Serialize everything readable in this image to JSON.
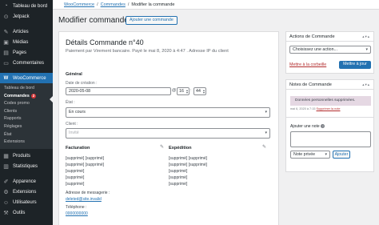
{
  "sidebar": {
    "top_items": [
      {
        "label": "Tableau de bord",
        "icon": "dashboard-icon",
        "glyph": "◔"
      },
      {
        "label": "Jetpack",
        "icon": "jetpack-icon",
        "glyph": "⊙"
      }
    ],
    "content_items": [
      {
        "label": "Articles",
        "icon": "pin-icon",
        "glyph": "✎"
      },
      {
        "label": "Médias",
        "icon": "media-icon",
        "glyph": "▣"
      },
      {
        "label": "Pages",
        "icon": "pages-icon",
        "glyph": "▤"
      },
      {
        "label": "Commentaires",
        "icon": "comments-icon",
        "glyph": "▭"
      }
    ],
    "woocommerce": {
      "label": "WooCommerce",
      "icon": "woocommerce-icon",
      "glyph": "W"
    },
    "submenu": [
      {
        "label": "Tableau de bord"
      },
      {
        "label": "Commandes",
        "badge": "2",
        "current": true
      },
      {
        "label": "Codes promo"
      },
      {
        "label": "Clients"
      },
      {
        "label": "Rapports"
      },
      {
        "label": "Réglages"
      },
      {
        "label": "État"
      },
      {
        "label": "Extensions"
      }
    ],
    "bottom_items": [
      {
        "label": "Produits",
        "icon": "products-icon",
        "glyph": "▦"
      },
      {
        "label": "Statistiques",
        "icon": "stats-icon",
        "glyph": "▥"
      },
      {
        "label": "Apparence",
        "icon": "appearance-icon",
        "glyph": "✐"
      },
      {
        "label": "Extensions",
        "icon": "plugins-icon",
        "glyph": "⚙"
      },
      {
        "label": "Utilisateurs",
        "icon": "users-icon",
        "glyph": "☺"
      },
      {
        "label": "Outils",
        "icon": "tools-icon",
        "glyph": "⚒"
      }
    ]
  },
  "breadcrumb": {
    "home": "WooCommerce",
    "section": "Commandes",
    "current": "Modifier la commande",
    "separator": "/"
  },
  "header": {
    "title": "Modifier commande",
    "add_button": "Ajouter une commande"
  },
  "order": {
    "title": "Détails Commande n°40",
    "subtitle": "Paiement par Virement bancaire. Payé le mai 8, 2020 à 4:47 . Adresse IP du client",
    "general": {
      "heading": "Général",
      "date_label": "Date de création :",
      "date_value": "2020-05-08",
      "at": "@",
      "hour": "16",
      "minute": "44",
      "status_label": "État :",
      "status_value": "En cours",
      "client_label": "Client :",
      "client_value": "Invité"
    },
    "billing": {
      "heading": "Facturation",
      "lines": [
        "[supprimé] [supprimé]",
        "[supprimé] [supprimé]",
        "[supprimé]",
        "[supprimé]",
        "[supprimé]"
      ],
      "email_label": "Adresse de messagerie :",
      "email_value": "deleted@site.invalid",
      "phone_label": "Téléphone :",
      "phone_value": "0000000000"
    },
    "shipping": {
      "heading": "Expédition",
      "lines": [
        "[supprimé] [supprimé]",
        "[supprimé] [supprimé]",
        "[supprimé]",
        "[supprimé]",
        "[supprimé]"
      ]
    }
  },
  "actions_box": {
    "title": "Actions de Commande",
    "select_placeholder": "Choisissez une action...",
    "trash_link": "Mettre à la corbeille",
    "update_button": "Mettre à jour"
  },
  "notes_box": {
    "title": "Notes de Commande",
    "note_text": "Données personnelles supprimées.",
    "note_date": "mai 6, 2020 à 7:15",
    "delete_link": "Supprimer la note",
    "add_label": "Ajouter une note",
    "note_type": "Note privée",
    "add_button": "Ajouter"
  },
  "colors": {
    "admin_bar": "#1d2327",
    "accent": "#2271b1",
    "note_bg": "#e5d8e3",
    "danger": "#b32d2e"
  }
}
